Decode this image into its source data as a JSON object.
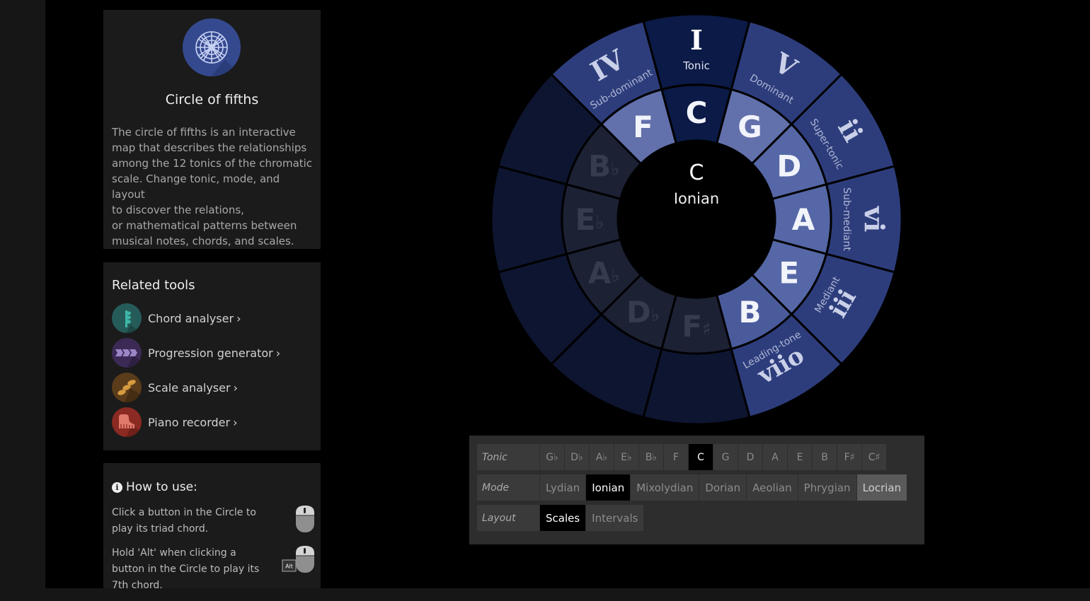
{
  "about": {
    "title": "Circle of fifths",
    "lines": [
      "The circle of fifths is an interactive",
      "map that describes the relationships",
      "among the 12 tonics of the chromatic",
      "scale. Change tonic, mode, and layout",
      "to discover the relations,",
      "or mathematical patterns between",
      "musical notes, chords, and scales."
    ]
  },
  "related": {
    "title": "Related tools",
    "items": [
      {
        "label": "Chord analyser",
        "icon": "chord-analyser-icon",
        "color": "#255c5a"
      },
      {
        "label": "Progression generator",
        "icon": "progression-generator-icon",
        "color": "#3b2a55"
      },
      {
        "label": "Scale analyser",
        "icon": "scale-analyser-icon",
        "color": "#5a3c1a"
      },
      {
        "label": "Piano recorder",
        "icon": "piano-recorder-icon",
        "color": "#8a2a22"
      }
    ],
    "chevron": "›"
  },
  "howto": {
    "title": "How to use:",
    "info_glyph": "i",
    "steps": [
      {
        "lines": [
          "Click a button in the Circle to",
          "play its triad chord."
        ],
        "icon": "mouse-click-icon"
      },
      {
        "lines": [
          "Hold 'Alt' when clicking a",
          "button in the Circle to play its",
          "7th chord."
        ],
        "icon": "alt-mouse-click-icon",
        "key": "Alt"
      }
    ]
  },
  "center": {
    "tonic": "C",
    "mode": "Ionian"
  },
  "wheel": {
    "colors": {
      "degree": "#2d3d7c",
      "tonic_seg": "#0b1a46",
      "major": "#6270ac",
      "minor": "#5567a6",
      "dim": "#4a5b9c",
      "inactive_outer": "#0e1530",
      "inactive_mid": "#1c2134"
    },
    "notes": [
      {
        "label": "C",
        "sharp": "",
        "flat": "",
        "active": true
      },
      {
        "label": "G",
        "sharp": "",
        "flat": "",
        "active": true
      },
      {
        "label": "D",
        "sharp": "",
        "flat": "",
        "active": true
      },
      {
        "label": "A",
        "sharp": "",
        "flat": "",
        "active": true
      },
      {
        "label": "E",
        "sharp": "",
        "flat": "",
        "active": true
      },
      {
        "label": "B",
        "sharp": "",
        "flat": "",
        "active": true
      },
      {
        "label": "F",
        "sharp": "♯",
        "flat": "",
        "active": false
      },
      {
        "label": "D",
        "sharp": "",
        "flat": "♭",
        "active": false
      },
      {
        "label": "A",
        "sharp": "",
        "flat": "♭",
        "active": false
      },
      {
        "label": "E",
        "sharp": "",
        "flat": "♭",
        "active": false
      },
      {
        "label": "B",
        "sharp": "",
        "flat": "♭",
        "active": false
      },
      {
        "label": "F",
        "sharp": "",
        "flat": "",
        "active": true
      }
    ],
    "degrees": [
      {
        "numeral": "I",
        "name": "Tonic"
      },
      {
        "numeral": "V",
        "name": "Dominant"
      },
      {
        "numeral": "ii",
        "name": "Super-tonic"
      },
      {
        "numeral": "vi",
        "name": "Sub-mediant"
      },
      {
        "numeral": "iii",
        "name": "Mediant"
      },
      {
        "numeral": "viio",
        "name": "Leading-tone"
      },
      {
        "numeral": "",
        "name": ""
      },
      {
        "numeral": "",
        "name": ""
      },
      {
        "numeral": "",
        "name": ""
      },
      {
        "numeral": "",
        "name": ""
      },
      {
        "numeral": "",
        "name": ""
      },
      {
        "numeral": "IV",
        "name": "Sub-dominant"
      }
    ]
  },
  "controls": {
    "tonic": {
      "label": "Tonic",
      "options": [
        "G♭",
        "D♭",
        "A♭",
        "E♭",
        "B♭",
        "F",
        "C",
        "G",
        "D",
        "A",
        "E",
        "B",
        "F♯",
        "C♯"
      ],
      "selected": "C"
    },
    "mode": {
      "label": "Mode",
      "options": [
        "Lydian",
        "Ionian",
        "Mixolydian",
        "Dorian",
        "Aeolian",
        "Phrygian",
        "Locrian"
      ],
      "selected": "Ionian",
      "alt": "Locrian"
    },
    "layout": {
      "label": "Layout",
      "options": [
        "Scales",
        "Intervals"
      ],
      "selected": "Scales"
    }
  }
}
